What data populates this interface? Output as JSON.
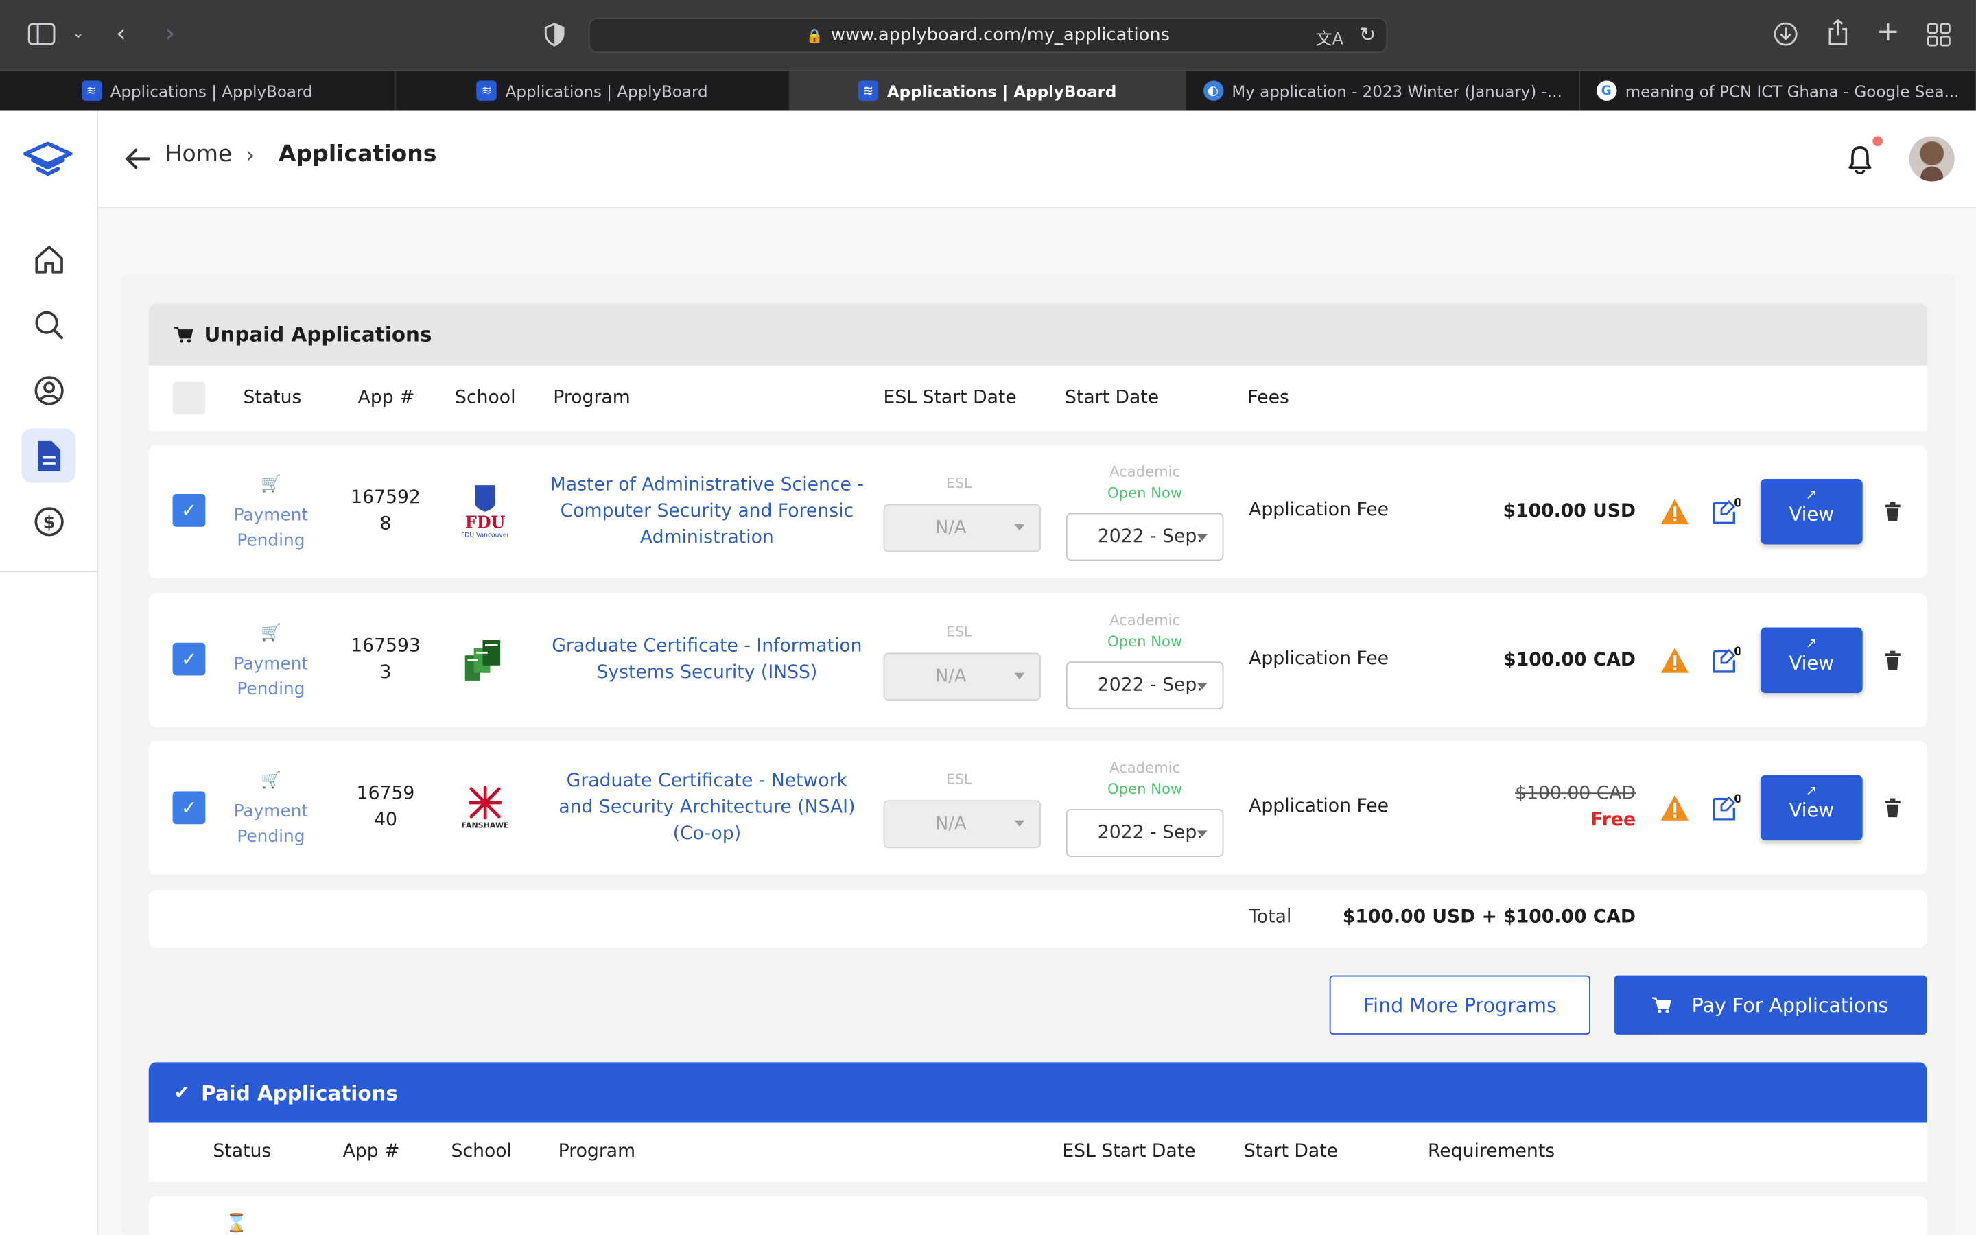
{
  "browser": {
    "url": "www.applyboard.com/my_applications",
    "tabs": [
      {
        "title": "Applications | ApplyBoard",
        "active": false
      },
      {
        "title": "Applications | ApplyBoard",
        "active": false
      },
      {
        "title": "Applications | ApplyBoard",
        "active": true
      },
      {
        "title": "My application - 2023 Winter (January) -...",
        "active": false
      },
      {
        "title": "meaning of PCN ICT Ghana - Google Sea...",
        "active": false
      }
    ]
  },
  "header": {
    "home_label": "Home",
    "current_label": "Applications"
  },
  "unpaid": {
    "title": "Unpaid Applications",
    "columns": [
      "Status",
      "App #",
      "School",
      "Program",
      "ESL Start Date",
      "Start Date",
      "Fees"
    ],
    "rows": [
      {
        "status": "Payment Pending",
        "app_no_1": "167592",
        "app_no_2": "8",
        "school": "FDU Vancouver",
        "program": "Master of Administrative Science - Computer Security and Forensic Administration",
        "esl_label": "ESL",
        "esl_value": "N/A",
        "academic_label": "Academic",
        "open_label": "Open Now",
        "start_value": "2022 - Sep.",
        "fee_name": "Application Fee",
        "fee_amount": "$100.00 USD",
        "fee_free": "",
        "notes_count": "0",
        "view_label": "View"
      },
      {
        "status": "Payment Pending",
        "app_no_1": "167593",
        "app_no_2": "3",
        "school": "",
        "program": "Graduate Certificate - Information Systems Security (INSS)",
        "esl_label": "ESL",
        "esl_value": "N/A",
        "academic_label": "Academic",
        "open_label": "Open Now",
        "start_value": "2022 - Sep.",
        "fee_name": "Application Fee",
        "fee_amount": "$100.00 CAD",
        "fee_free": "",
        "notes_count": "0",
        "view_label": "View"
      },
      {
        "status": "Payment Pending",
        "app_no_1": "16759",
        "app_no_2": "40",
        "school": "FANSHAWE",
        "program": "Graduate Certificate - Network and Security Architecture (NSAI) (Co-op)",
        "esl_label": "ESL",
        "esl_value": "N/A",
        "academic_label": "Academic",
        "open_label": "Open Now",
        "start_value": "2022 - Sep.",
        "fee_name": "Application Fee",
        "fee_amount": "$100.00 CAD",
        "fee_free": "Free",
        "notes_count": "0",
        "view_label": "View"
      }
    ],
    "total_label": "Total",
    "total_value": "$100.00 USD + $100.00 CAD",
    "find_more_label": "Find More Programs",
    "pay_label": "Pay For Applications"
  },
  "paid": {
    "title": "Paid Applications",
    "columns": [
      "Status",
      "App #",
      "School",
      "Program",
      "ESL Start Date",
      "Start Date",
      "Requirements"
    ]
  },
  "colors": {
    "primary": "#2a5bd7",
    "link": "#2f5fb7",
    "open_now": "#4cc76d",
    "warning": "#f08c1a",
    "free": "#e02626"
  }
}
